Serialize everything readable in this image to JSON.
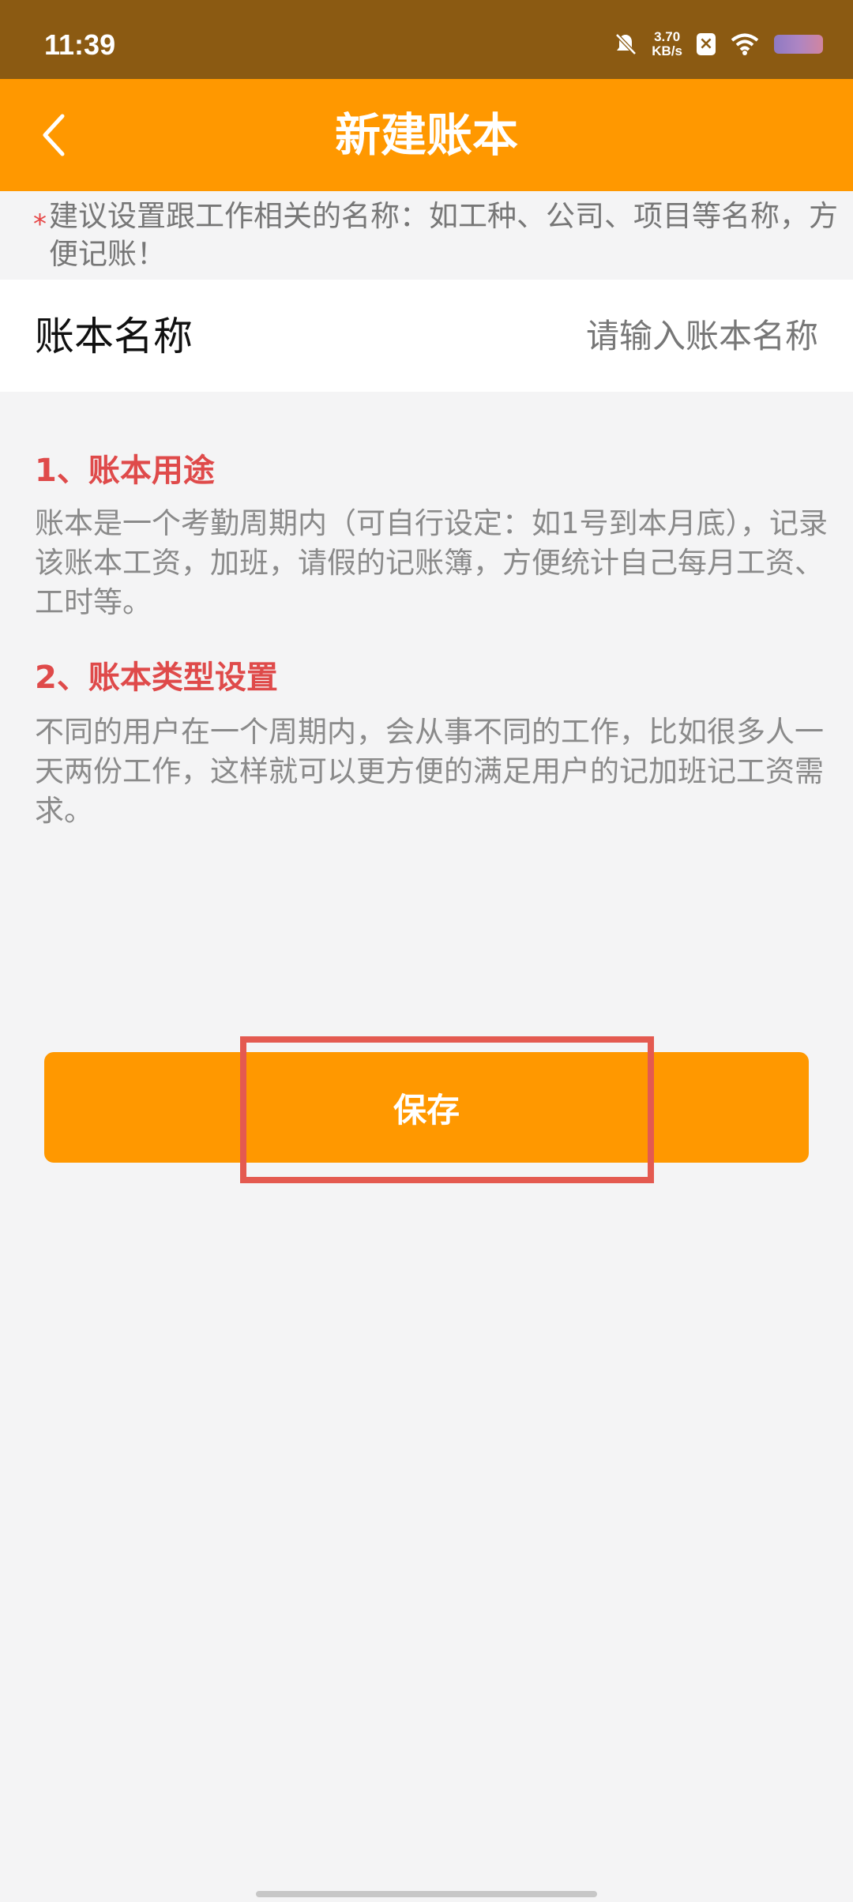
{
  "status_bar": {
    "time": "11:39",
    "network_speed_value": "3.70",
    "network_speed_unit": "KB/s",
    "icons": [
      "bell-muted-icon",
      "sim-x-icon",
      "wifi-icon",
      "battery-icon"
    ]
  },
  "header": {
    "title": "新建账本",
    "back_icon": "chevron-left-icon"
  },
  "notice": {
    "marker": "*",
    "text": "建议设置跟工作相关的名称：如工种、公司、项目等名称，方便记账！"
  },
  "ledger_name": {
    "label": "账本名称",
    "value": "",
    "placeholder": "请输入账本名称"
  },
  "info": [
    {
      "title": "1、账本用途",
      "body": "账本是一个考勤周期内（可自行设定：如1号到本月底），记录该账本工资，加班，请假的记账簿，方便统计自己每月工资、工时等。"
    },
    {
      "title": "2、账本类型设置",
      "body": "不同的用户在一个周期内，会从事不同的工作，比如很多人一天两份工作，这样就可以更方便的满足用户的记加班记工资需求。"
    }
  ],
  "actions": {
    "save_label": "保存"
  },
  "colors": {
    "status_bar": "#8b5a12",
    "accent": "#ff9800",
    "section_title": "#df4a4a",
    "highlight": "#e45a50"
  }
}
